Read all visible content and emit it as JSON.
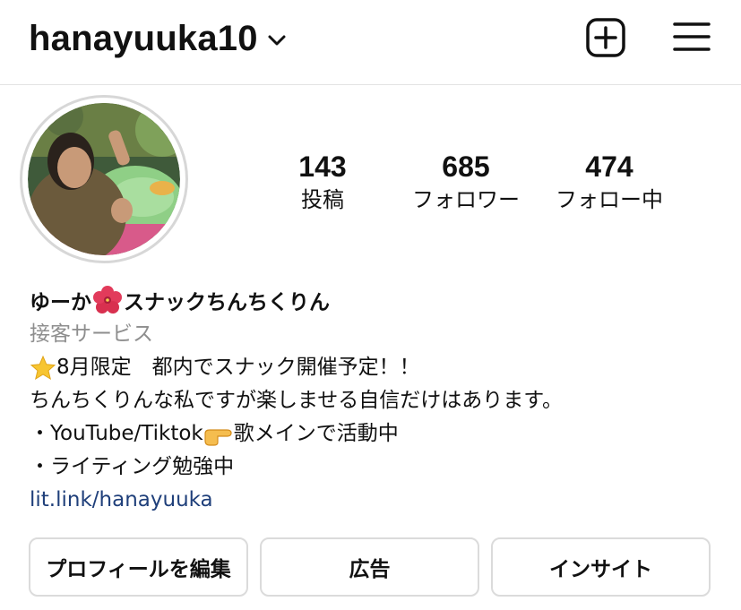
{
  "header": {
    "username": "hanayuuka10"
  },
  "stats": [
    {
      "value": "143",
      "label": "投稿"
    },
    {
      "value": "685",
      "label": "フォロワー"
    },
    {
      "value": "474",
      "label": "フォロー中"
    }
  ],
  "profile": {
    "name_part1": "ゆーか",
    "name_part2": "スナックちんちくりん",
    "category": "接客サービス",
    "bio_line1": "8月限定　都内でスナック開催予定！！",
    "bio_line2": "ちんちくりんな私ですが楽しませる自信だけはあります。",
    "bio_line3a": "・YouTube/Tiktok",
    "bio_line3b": "歌メインで活動中",
    "bio_line4": "・ライティング勉強中",
    "link": "lit.link/hanayuuka"
  },
  "buttons": {
    "edit_profile": "プロフィールを編集",
    "ads": "広告",
    "insights": "インサイト"
  },
  "icons": {
    "dropdown": "chevron-down-icon",
    "add": "plus-square-icon",
    "menu": "hamburger-menu-icon",
    "name_emoji": "hibiscus-icon",
    "bio_emoji_1": "star-icon",
    "bio_emoji_2": "pointing-hand-icon"
  },
  "colors": {
    "text": "#111111",
    "secondary": "#8e8e8e",
    "link": "#1f3f7a",
    "border": "#dbdbdb"
  }
}
